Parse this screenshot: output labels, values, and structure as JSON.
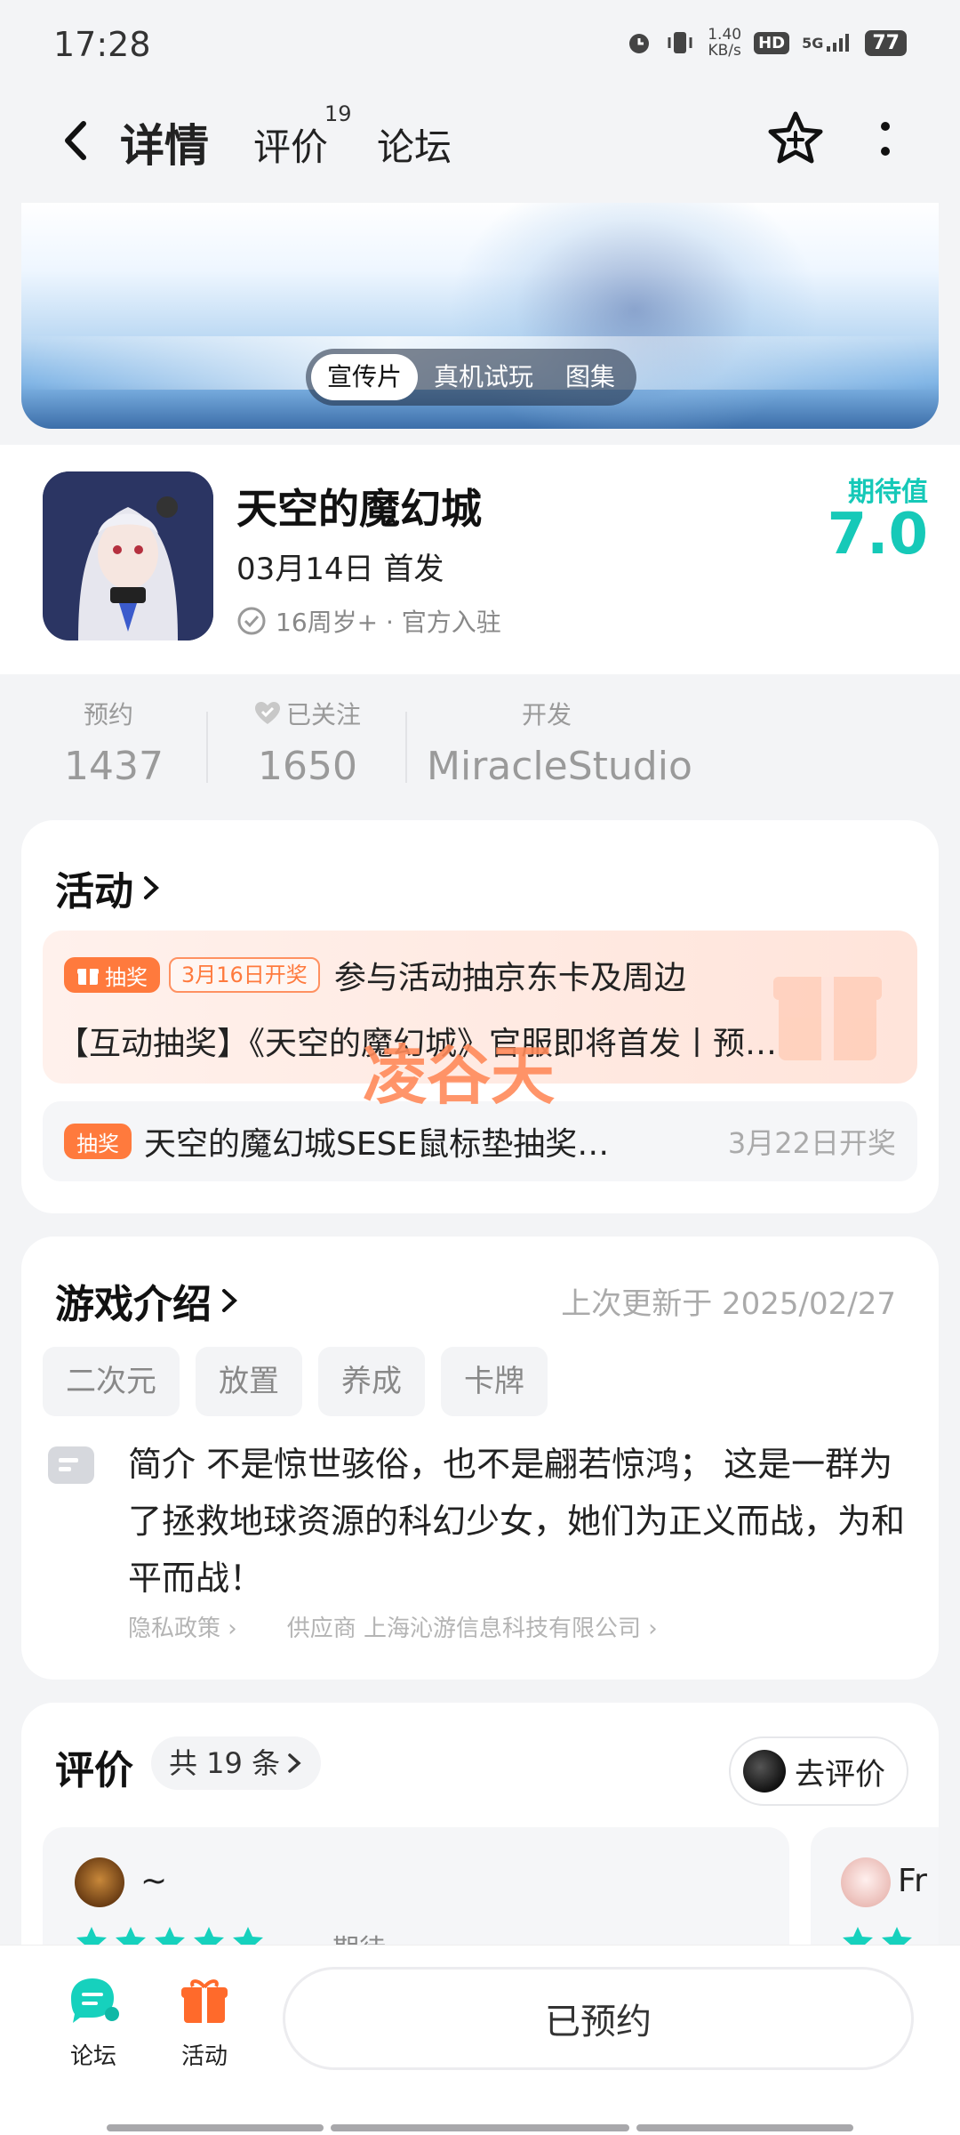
{
  "status_bar": {
    "time": "17:28",
    "net_speed_value": "1.40",
    "net_speed_unit": "KB/s",
    "hd": "HD",
    "network": "5G",
    "battery": "77"
  },
  "header": {
    "tabs": [
      {
        "label": "详情",
        "active": true
      },
      {
        "label": "评价",
        "badge": "19"
      },
      {
        "label": "论坛"
      }
    ],
    "accent_color": "#17d2c0"
  },
  "banner": {
    "media_tabs": [
      "宣传片",
      "真机试玩",
      "图集"
    ],
    "active_media_tab": "宣传片"
  },
  "game": {
    "title": "天空的魔幻城",
    "release": "03月14日 首发",
    "meta": "16周岁+ · 官方入驻",
    "expect_label": "期待值",
    "expect_value": "7.0"
  },
  "stats": [
    {
      "label": "预约",
      "value": "1437"
    },
    {
      "label": "已关注",
      "value": "1650"
    },
    {
      "label": "开发",
      "value": "MiracleStudio"
    }
  ],
  "activity": {
    "title": "活动",
    "highlight": {
      "tag": "抽奖",
      "date_tag": "3月16日开奖",
      "title": "参与活动抽京东卡及周边",
      "desc": "【互动抽奖】《天空的魔幻城》官服即将首发丨预…"
    },
    "watermark": "凌谷天",
    "items": [
      {
        "tag": "抽奖",
        "title": "天空的魔幻城SESE鼠标垫抽奖…",
        "date": "3月22日开奖"
      }
    ]
  },
  "intro": {
    "title": "游戏介绍",
    "updated": "上次更新于 2025/02/27",
    "tags": [
      "二次元",
      "放置",
      "养成",
      "卡牌"
    ],
    "text": "简介 不是惊世骇俗，也不是翩若惊鸿； 这是一群为了拯救地球资源的科幻少女，她们为正义而战，为和平而战！",
    "privacy": "隐私政策",
    "supplier": "供应商 上海沁游信息科技有限公司"
  },
  "reviews": {
    "title": "评价",
    "count": "共 19 条",
    "go_review": "去评价",
    "items": [
      {
        "name": "~",
        "stars": 5,
        "tag": "期待"
      },
      {
        "name": "Fr"
      }
    ]
  },
  "bottom_bar": {
    "forum": "论坛",
    "activity": "活动",
    "reserved": "已预约"
  }
}
